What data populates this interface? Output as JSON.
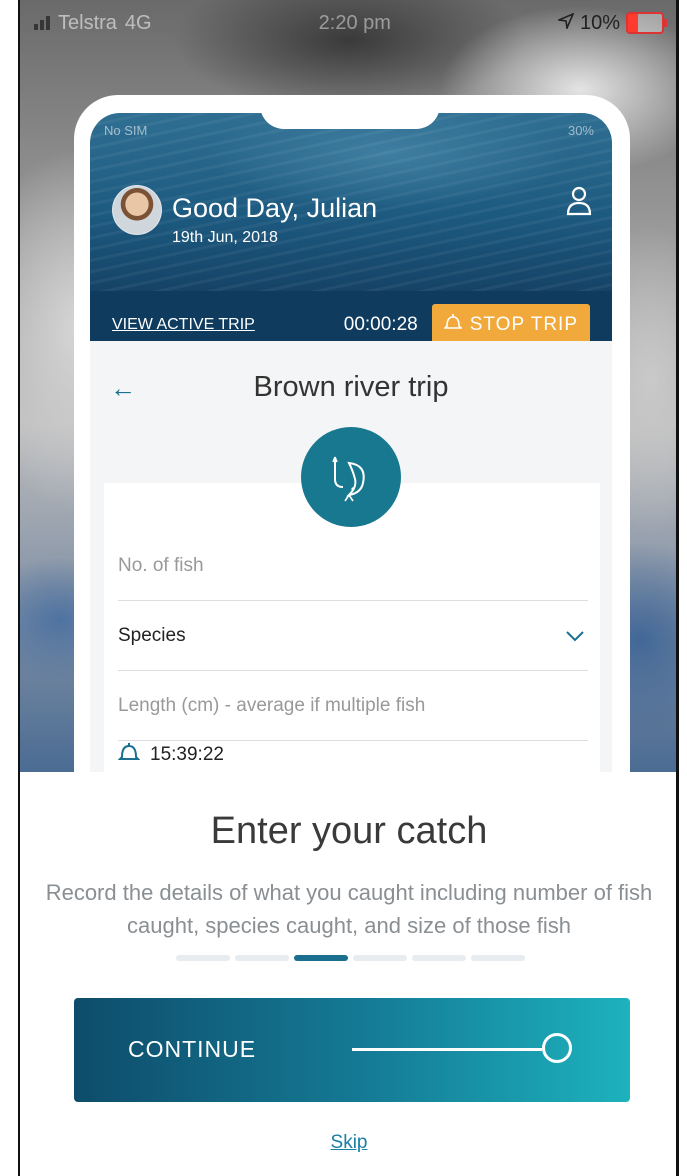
{
  "status_bar": {
    "carrier": "Telstra",
    "network": "4G",
    "time": "2:20 pm",
    "battery": "10%"
  },
  "inner_status": {
    "carrier": "No SIM",
    "battery": "30%"
  },
  "header": {
    "greeting": "Good Day, Julian",
    "date": "19th Jun, 2018"
  },
  "trip_bar": {
    "view_link": "VIEW ACTIVE TRIP",
    "timer": "00:00:28",
    "stop_label": "STOP TRIP"
  },
  "trip": {
    "title": "Brown river trip"
  },
  "form": {
    "fish_placeholder": "No. of fish",
    "species_label": "Species",
    "length_placeholder": "Length (cm) - average if multiple fish",
    "time": "15:39:22"
  },
  "onboarding": {
    "title": "Enter your catch",
    "description": "Record the details of what you caught including number of fish caught, species caught, and size of those fish",
    "step": 3,
    "total_steps": 6,
    "continue_label": "CONTINUE",
    "skip_label": "Skip"
  },
  "colors": {
    "accent": "#1a6f8e",
    "stop_button": "#f2a93b",
    "header_dark": "#0f3c5e"
  }
}
